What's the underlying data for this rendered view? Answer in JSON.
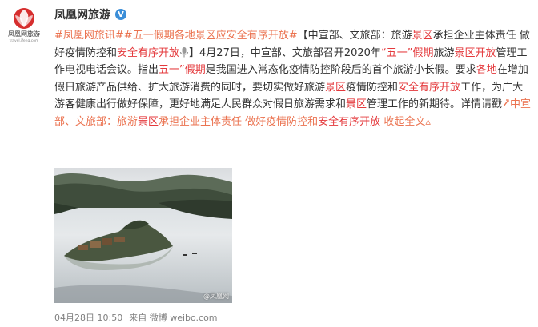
{
  "author": {
    "name": "凤凰网旅游",
    "verified_badge": "V",
    "avatar_caption": "凤凰网旅游",
    "avatar_url_text": "travel.ifeng.com"
  },
  "post": {
    "tag1": "#凤凰网旅讯#",
    "tag2": "#五一假期各地景区应安全有序开放#",
    "title_open": "【中宣部、文旅部：旅游",
    "title_hl1": "景区",
    "title_mid": "承担企业主体责任 做好疫情防控和",
    "title_hl2": "安全有序开放",
    "title_close": "】4月27日，中宣部、文旅部召开2020年",
    "quote_open": "“",
    "hl_wuyi": "五一",
    "quote_close": "”",
    "hl_jiaqi": "假期",
    "t1": "旅游",
    "hl_jingqu1": "景区开放",
    "t2": "管理工作电视电话会议。指出",
    "hl_wuyi2": "五一",
    "hl_jiaqi2": "”假期",
    "t3": "是我国进入常态化疫情防控阶段后的首个旅游小长假。要求",
    "hl_gedi": "各地",
    "t4": "在增加假日旅游产品供给、扩大旅游消费的同时，要切实做好旅游",
    "hl_jingqu2": "景区",
    "t5": "疫情防控和",
    "hl_anquan": "安全有序开放",
    "t6": "工作，为广大游客健康出行做好保障，更好地满足人民群众对假日旅游需求和",
    "hl_jingqu3": "景区",
    "t7": "管理工作的新期待。详情请戳",
    "link_pre": "中宣部、文旅部：旅游",
    "link_hl1": "景区",
    "link_mid": "承担企业主体责任 做好疫情防控和",
    "link_hl2": "安全有序开放",
    "collapse": "收起全文",
    "collapse_icon": "▵"
  },
  "image": {
    "watermark": "@凤凰网"
  },
  "footer": {
    "time": "04月28日 10:50",
    "source": "来自 微博 weibo.com"
  },
  "colors": {
    "link": "#eb7350",
    "highlight": "#e4393c",
    "verified": "#3b8ed8"
  }
}
